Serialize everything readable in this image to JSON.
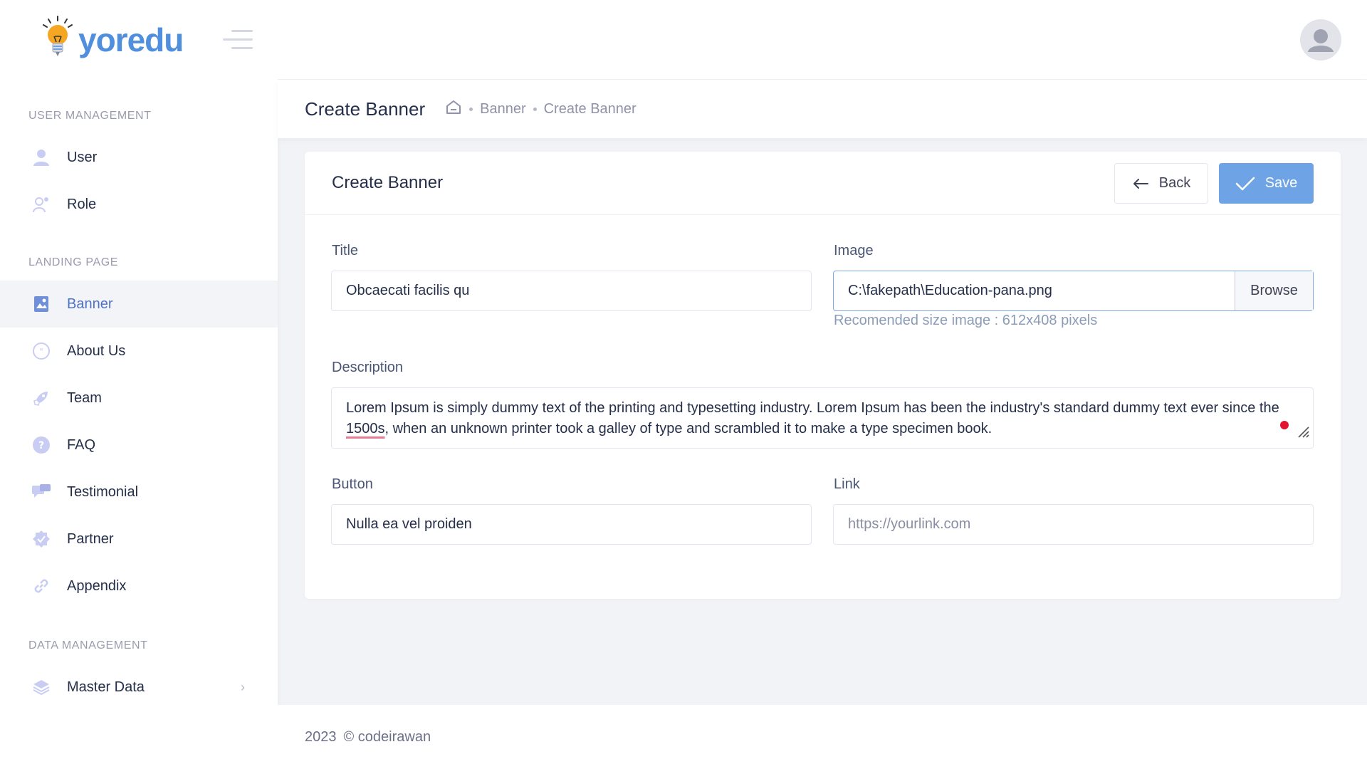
{
  "brand": {
    "name": "yoredu"
  },
  "sidebar": {
    "sections": [
      {
        "title": "USER MANAGEMENT"
      },
      {
        "title": "LANDING PAGE"
      },
      {
        "title": "DATA MANAGEMENT"
      }
    ],
    "items": [
      {
        "label": "User",
        "icon": "user-icon"
      },
      {
        "label": "Role",
        "icon": "role-icon"
      },
      {
        "label": "Banner",
        "icon": "banner-icon",
        "active": true
      },
      {
        "label": "About Us",
        "icon": "about-icon"
      },
      {
        "label": "Team",
        "icon": "rocket-icon"
      },
      {
        "label": "FAQ",
        "icon": "question-icon"
      },
      {
        "label": "Testimonial",
        "icon": "chat-icon"
      },
      {
        "label": "Partner",
        "icon": "badge-check-icon"
      },
      {
        "label": "Appendix",
        "icon": "link-icon"
      },
      {
        "label": "Master Data",
        "icon": "layers-icon"
      }
    ]
  },
  "toolbar": {
    "page_title": "Create Banner",
    "breadcrumb": [
      "Banner",
      "Create Banner"
    ]
  },
  "card": {
    "title": "Create Banner",
    "back_label": "Back",
    "save_label": "Save"
  },
  "form": {
    "title": {
      "label": "Title",
      "value": "Obcaecati facilis qu"
    },
    "image": {
      "label": "Image",
      "value": "C:\\fakepath\\Education-pana.png",
      "browse_label": "Browse",
      "hint": "Recomended size image : 612x408 pixels"
    },
    "description": {
      "label": "Description",
      "value_before": "Lorem Ipsum is simply dummy text of the printing and typesetting industry. Lorem Ipsum has been the industry's standard dummy text ever since the ",
      "value_marked": "1500s",
      "value_after": ", when an unknown printer took a galley of type and scrambled it to make a type specimen book."
    },
    "button": {
      "label": "Button",
      "value": "Nulla ea vel proiden"
    },
    "link": {
      "label": "Link",
      "placeholder": "https://yourlink.com"
    }
  },
  "footer": {
    "year": "2023",
    "copyright": "© codeirawan"
  },
  "colors": {
    "accent": "#4f73c4",
    "save": "#6ea4e6",
    "brand": "#4f8fdd"
  }
}
